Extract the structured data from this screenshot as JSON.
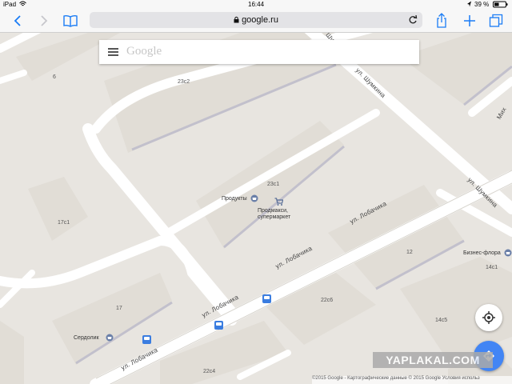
{
  "status_bar": {
    "device": "iPad",
    "time": "16:44",
    "battery": "39 %"
  },
  "browser": {
    "url": "google.ru",
    "icons": [
      "back-icon",
      "forward-icon",
      "bookmarks-icon",
      "lock-icon",
      "reload-icon",
      "share-icon",
      "new-tab-icon",
      "tabs-icon"
    ]
  },
  "maps": {
    "search_logo": "Google",
    "streets": [
      "ул. Шумкина",
      "ул. Шумкина",
      "ул. Шумкина",
      "ул. Лобачика",
      "ул. Лобачика",
      "ул. Лобачика",
      "ул. Лобачика",
      "Мих"
    ],
    "buildings": [
      "6",
      "23с2",
      "23с1",
      "17с1",
      "17",
      "12",
      "22с6",
      "14с1",
      "14с5",
      "22с4"
    ],
    "pois": {
      "products": "Продукты",
      "prodmax_line1": "Продмакси,",
      "prodmax_line2": "супермаркет",
      "business_flora": "Бизнес-флора",
      "serdolik": "Сердолик"
    },
    "attribution": "©2015 Google - Картографические данные © 2015 Google   Условия использ",
    "colors": {
      "road": "#ffffff",
      "land": "#e8e5e0",
      "block": "#e0dcd5",
      "accent": "#4285f4"
    }
  },
  "watermark": "YAPLAKAL.COM"
}
